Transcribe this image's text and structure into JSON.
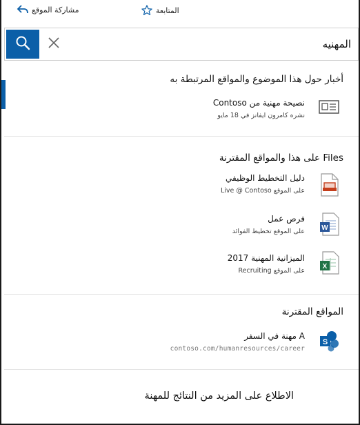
{
  "topbar": {
    "share_label": "مشاركة الموقع",
    "follow_label": "المتابعة"
  },
  "search": {
    "value": "المهنيه",
    "placeholder": ""
  },
  "news_section": {
    "title": "أخبار حول هذا الموضوع والمواقع المرتبطة به",
    "items": [
      {
        "title": "نصيحة مهنية من Contoso",
        "subtitle": "نشره كامرون ايفانز في 18 مايو",
        "icon": "news-icon"
      }
    ]
  },
  "files_section": {
    "title": "Files على هذا والمواقع المقترنة",
    "items": [
      {
        "title": "دليل التخطيط الوظيفي",
        "subtitle": "على الموقع Live @ Contoso",
        "icon": "powerpoint-file-icon",
        "color": "#c43e1c"
      },
      {
        "title": "فرص عمل",
        "subtitle": "على الموقع تخطيط الفوائد",
        "icon": "word-file-icon",
        "color": "#2b579a"
      },
      {
        "title": "الميزانية المهنية 2017",
        "subtitle": "على الموقع Recruiting",
        "icon": "excel-file-icon",
        "color": "#217346"
      }
    ]
  },
  "sites_section": {
    "title": "المواقع المقترنة",
    "items": [
      {
        "title": "A مهنة في السفر",
        "url": "contoso.com/humanresources/career",
        "icon": "sharepoint-site-icon",
        "color": "#0b5fa8"
      }
    ]
  },
  "footer": {
    "more_link": "الاطلاع على المزيد من النتائج للمهنة"
  },
  "colors": {
    "accent": "#0b5fa8"
  }
}
